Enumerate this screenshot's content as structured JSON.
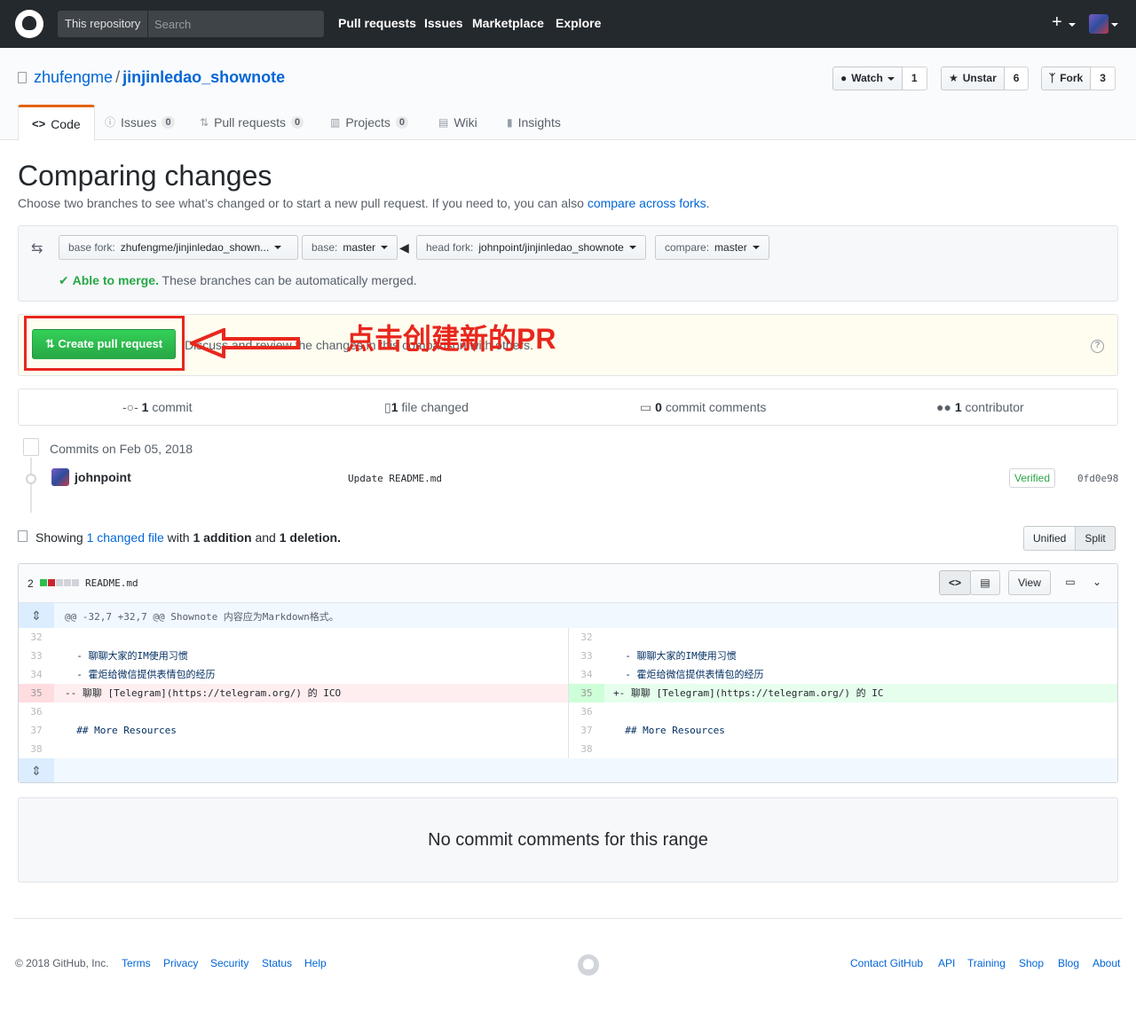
{
  "header": {
    "scope": "This repository",
    "search_placeholder": "Search",
    "nav": [
      "Pull requests",
      "Issues",
      "Marketplace",
      "Explore"
    ],
    "plus": "+"
  },
  "repo": {
    "owner": "zhufengme",
    "sep": "/",
    "name": "jinjinledao_shownote",
    "watch_label": "Watch",
    "watch_count": "1",
    "star_label": "Unstar",
    "star_count": "6",
    "fork_label": "Fork",
    "fork_count": "3"
  },
  "tabs": [
    {
      "label": "Code",
      "icon": "<>"
    },
    {
      "label": "Issues",
      "count": "0"
    },
    {
      "label": "Pull requests",
      "count": "0"
    },
    {
      "label": "Projects",
      "count": "0"
    },
    {
      "label": "Wiki"
    },
    {
      "label": "Insights"
    }
  ],
  "compare": {
    "title": "Comparing changes",
    "desc_prefix": "Choose two branches to see what’s changed or to start a new pull request. If you need to, you can also ",
    "desc_link": "compare across forks",
    "desc_suffix": ".",
    "base_fork_pre": "base fork:",
    "base_fork": "zhufengme/jinjinledao_shown...",
    "base_pre": "base:",
    "base": "master",
    "head_fork_pre": "head fork:",
    "head_fork": "johnpoint/jinjinledao_shownote",
    "compare_pre": "compare:",
    "compare": "master",
    "merge_ok": "Able to merge.",
    "merge_desc": "These branches can be automatically merged."
  },
  "pr": {
    "create_label": "Create pull request",
    "desc": "Discuss and review the changes in this comparison with others.",
    "annotation": "点击创建新的PR"
  },
  "stats": {
    "commits_num": "1",
    "commits_label": "commit",
    "files_num": "1",
    "files_label": "file changed",
    "comments_num": "0",
    "comments_label": "commit comments",
    "contrib_num": "1",
    "contrib_label": "contributor"
  },
  "commits": {
    "heading": "Commits on Feb 05, 2018",
    "author": "johnpoint",
    "message": "Update README.md",
    "verified": "Verified",
    "sha": "0fd0e98"
  },
  "showing": {
    "prefix": "Showing",
    "link": "1 changed file",
    "mid": "with",
    "additions": "1 addition",
    "and": "and",
    "deletions": "1 deletion.",
    "unified": "Unified",
    "split": "Split"
  },
  "file": {
    "count": "2",
    "name": "README.md",
    "view_label": "View",
    "hunk": "@@ -32,7 +32,7 @@ Shownote 内容应为Markdown格式。",
    "left_lines": [
      {
        "num": "32",
        "code": ""
      },
      {
        "num": "33",
        "code": "  - 聊聊大家的IM使用习惯"
      },
      {
        "num": "34",
        "code": "  - 霍炬给微信提供表情包的经历"
      },
      {
        "num": "35",
        "code": "-- 聊聊 [Telegram](https://telegram.org/) 的 ICO"
      },
      {
        "num": "36",
        "code": ""
      },
      {
        "num": "37",
        "code": "  ## More Resources"
      },
      {
        "num": "38",
        "code": ""
      }
    ],
    "right_lines": [
      {
        "num": "32",
        "code": ""
      },
      {
        "num": "33",
        "code": "  - 聊聊大家的IM使用习惯"
      },
      {
        "num": "34",
        "code": "  - 霍炬给微信提供表情包的经历"
      },
      {
        "num": "35",
        "code": "+- 聊聊 [Telegram](https://telegram.org/) 的 IC"
      },
      {
        "num": "36",
        "code": ""
      },
      {
        "num": "37",
        "code": "  ## More Resources"
      },
      {
        "num": "38",
        "code": ""
      }
    ]
  },
  "no_comments": "No commit comments for this range",
  "footer": {
    "copyright": "© 2018 GitHub, Inc.",
    "left_links": [
      "Terms",
      "Privacy",
      "Security",
      "Status",
      "Help"
    ],
    "right_links": [
      "Contact GitHub",
      "API",
      "Training",
      "Shop",
      "Blog",
      "About"
    ]
  },
  "colors": {
    "header_bg": "#24292e",
    "link": "#0366d6",
    "green": "#28a745",
    "annotation_red": "#e8271d",
    "deletion_bg": "#ffeef0",
    "addition_bg": "#e6ffed"
  }
}
